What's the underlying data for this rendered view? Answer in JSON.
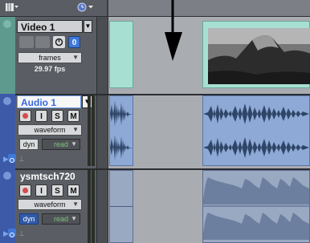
{
  "header": {
    "view_menu_icon": "track-list-icon",
    "clock_icon": "clock-icon"
  },
  "tracks": [
    {
      "id": "video",
      "name": "Video 1",
      "view": "frames",
      "fps": "29.97 fps",
      "color": "#5f9a8e"
    },
    {
      "id": "audio1",
      "name": "Audio 1",
      "buttons": [
        "I",
        "S",
        "M"
      ],
      "view": "waveform",
      "automation": "dyn",
      "automation_mode": "read",
      "color": "#3c5aa8"
    },
    {
      "id": "ysmtsch",
      "name": "ysmtsch720",
      "buttons": [
        "I",
        "S",
        "M"
      ],
      "view": "waveform",
      "automation": "dyn",
      "automation_mode": "read",
      "color": "#3c5aa8"
    }
  ],
  "colors": {
    "video_clip": "#a7e0d2",
    "audio_clip": "#8ea9d6",
    "gray_clip": "#9aa9c2",
    "wave_dark": "#2f4668",
    "record_red": "#d84b4b",
    "read_green": "#7ec27a"
  }
}
